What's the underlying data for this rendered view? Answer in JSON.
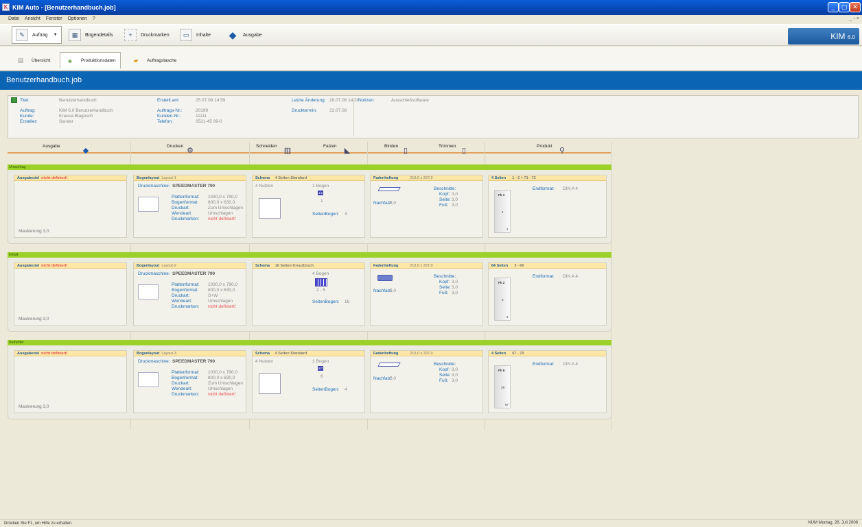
{
  "window": {
    "title": "KIM Auto - [Benutzerhandbuch.job]",
    "controls": {
      "min": "_",
      "max": "▢",
      "close": "✕"
    }
  },
  "menu": [
    "Datei",
    "Ansicht",
    "Fenster",
    "Optionen",
    "?"
  ],
  "toolbar": {
    "auftrag": "Auftrag",
    "bogendetails": "Bogendetails",
    "druckmarken": "Druckmarken",
    "inhalte": "Inhalte",
    "ausgabe": "Ausgabe",
    "logo_text": "KIM",
    "logo_version": "6.0"
  },
  "tabs": {
    "uebersicht": "Übersicht",
    "produktionsdaten": "Produktionsdaten",
    "auftragstasche": "Auftragstasche"
  },
  "job": {
    "name": "Benutzerhandbuch.job"
  },
  "info": {
    "titel_label": "Titel:",
    "titel": "Benutzerhandbuch",
    "auftrag_label": "Auftrag:",
    "auftrag": "KIM 6.0 Benutzerhandbuch",
    "kunde_label": "Kunde:",
    "kunde": "Krause-Biagosch",
    "ersteller_label": "Ersteller:",
    "ersteller": "Sander",
    "erstellt_label": "Erstellt am:",
    "erstellt": "25.07.08 14:59",
    "auftragsnr_label": "Auftrags-Nr.:",
    "auftragsnr": "20199",
    "kundennr_label": "Kunden-Nr.:",
    "kundennr": "11111",
    "telefon_label": "Telefon:",
    "telefon": "0521-45 99-0",
    "aenderung_label": "Letzte Änderung:",
    "aenderung": "28.07.08 14:30",
    "drucktermin_label": "Drucktermin:",
    "drucktermin": "22.07.08",
    "notizen_label": "Notizen:",
    "notizen": "Ausschießsoftware"
  },
  "steps": {
    "ausgabe": "Ausgabe",
    "drucken": "Drucken",
    "schneiden": "Schneiden",
    "falzen": "Falzen",
    "binden": "Binden",
    "trimmen": "Trimmen",
    "produkt": "Produkt"
  },
  "common": {
    "ausgabeziel": "Ausgabeziel",
    "nicht_definiert": "nicht definiert!",
    "maskierung": "Maskierung 3,0",
    "bogenlayout": "Bogenlayout",
    "druckmaschine_label": "Druckmaschine:",
    "druckmaschine": "SPEEDMASTER 790",
    "plattenformat_label": "Plattenformat:",
    "plattenformat": "1030,0 x 790,0",
    "bogenformat_label": "Bogenformat:",
    "bogenformat": "800,0 x 630,0",
    "druckart_label": "Druckart:",
    "wendeart_label": "Wendeart:",
    "druckmarken_label": "Druckmarken:",
    "schema": "Schema",
    "fadenheftung": "Fadenheftung",
    "format": "210,0 x 297,0",
    "nachfalz_label": "Nachfalz:",
    "nachfalz": "5,0",
    "beschnitte_label": "Beschnitte:",
    "kopf_label": "Kopf:",
    "seite_label": "Seite:",
    "fuss_label": "Fuß:",
    "beschnitt_val": "3,0",
    "seitenbogen_label": "SeitenBogen:",
    "endformat_label": "Endformat:",
    "endformat": "DIN A 4"
  },
  "sections": [
    {
      "name": "Umschlag",
      "layout": "Layout-1",
      "druckart": "Zum Umschlagen",
      "wendeart": "Umschlagen",
      "schema_name": "4 Seiten Standard",
      "nutzen": "4 Nutzen",
      "bogen": "1 Bogen",
      "bogen_badge": "1/2",
      "bogen_sub": "1",
      "seitenbogen": "4",
      "produkt_seiten": "4 Seiten",
      "produkt_range": "1 - 2 + 71 - 72",
      "fb": "Fb 1",
      "fb_small": "1",
      "page_no": "1"
    },
    {
      "name": "Inhalt",
      "layout": "Layout-2",
      "druckart": "S+W",
      "wendeart": "Umschlagen",
      "schema_name": "16 Seiten Kreuzbruch",
      "nutzen": "",
      "bogen": "4 Bogen",
      "bogen_badge": "",
      "bogen_sub": "2 - 5",
      "seitenbogen": "16",
      "produkt_seiten": "64 Seiten",
      "produkt_range": "3 - 66",
      "fb": "Fb 2",
      "fb_small": "3",
      "page_no": "3"
    },
    {
      "name": "Beihefter",
      "layout": "Layout-3",
      "druckart": "Zum Umschlagen",
      "wendeart": "Umschlagen",
      "schema_name": "4 Seiten Standard",
      "nutzen": "4 Nutzen",
      "bogen": "1 Bogen",
      "bogen_badge": "6/7",
      "bogen_sub": "6",
      "seitenbogen": "4",
      "produkt_seiten": "4 Seiten",
      "produkt_range": "67 - 70",
      "fb": "Fb 6",
      "fb_small": "29",
      "page_no": "67"
    }
  ],
  "status": {
    "left": "Drücken Sie F1, um Hilfe zu erhalten.",
    "right": "NUM   Montag, 28. Juli 2008"
  }
}
